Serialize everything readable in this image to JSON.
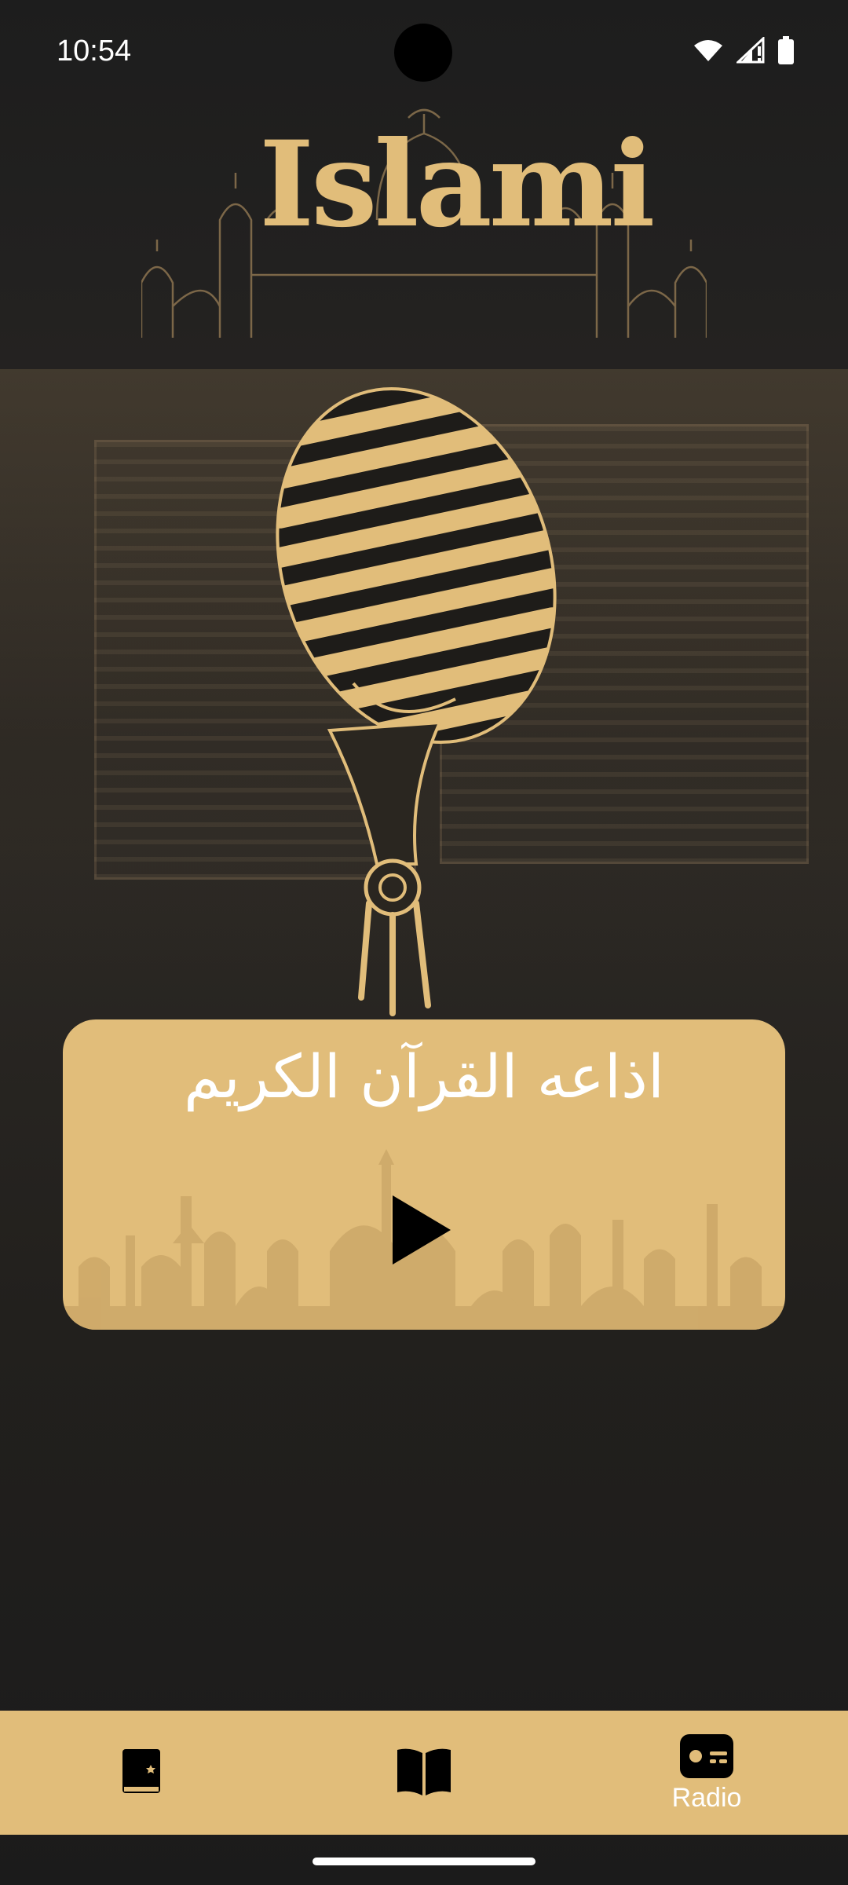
{
  "status": {
    "time": "10:54",
    "icons": [
      "wifi-icon",
      "signal-icon",
      "battery-icon"
    ]
  },
  "logo": {
    "text": "Islami",
    "color": "#e1bd7a"
  },
  "radio_card": {
    "title": "اذاعه القرآن الكريم",
    "play_icon": "play-icon",
    "background": "#e1bd7a"
  },
  "bottom_nav": {
    "items": [
      {
        "icon": "quran-book-icon",
        "label": ""
      },
      {
        "icon": "open-book-icon",
        "label": ""
      },
      {
        "icon": "radio-icon",
        "label": "Radio"
      }
    ],
    "background": "#e1bd7a",
    "active_index": 2
  }
}
